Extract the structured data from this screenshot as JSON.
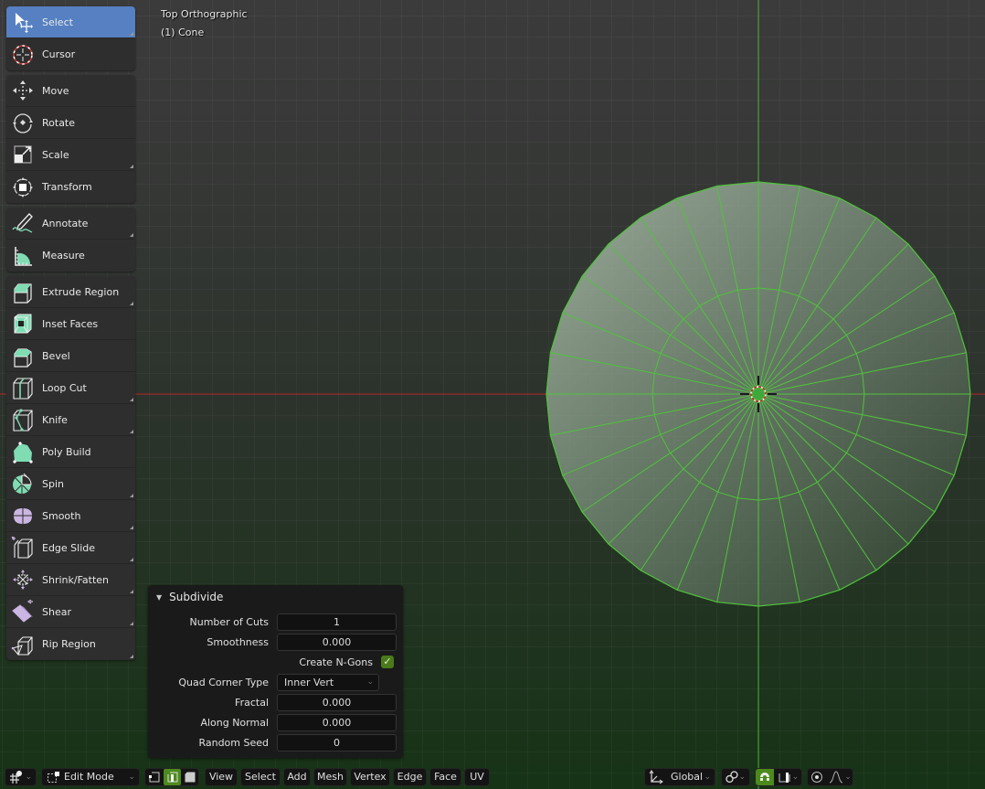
{
  "viewport": {
    "view_name": "Top Orthographic",
    "object_label": "(1) Cone",
    "mesh": {
      "segments": 32,
      "subdivision_rings": 2,
      "selected": true
    },
    "colors": {
      "x_axis": "#b22222",
      "y_axis": "#4caf39",
      "mesh_edge": "#4ec43a",
      "mesh_face": "#a3b8a3"
    }
  },
  "toolbar": {
    "groups": [
      [
        {
          "name": "select",
          "label": "Select",
          "icon": "select-box-icon",
          "active": true,
          "has_submenu": true
        },
        {
          "name": "cursor",
          "label": "Cursor",
          "icon": "cursor-icon",
          "active": false,
          "has_submenu": false
        }
      ],
      [
        {
          "name": "move",
          "label": "Move",
          "icon": "move-icon",
          "has_submenu": false
        },
        {
          "name": "rotate",
          "label": "Rotate",
          "icon": "rotate-icon",
          "has_submenu": false
        },
        {
          "name": "scale",
          "label": "Scale",
          "icon": "scale-icon",
          "has_submenu": true
        },
        {
          "name": "transform",
          "label": "Transform",
          "icon": "transform-icon",
          "has_submenu": false
        }
      ],
      [
        {
          "name": "annotate",
          "label": "Annotate",
          "icon": "annotate-icon",
          "has_submenu": true
        },
        {
          "name": "measure",
          "label": "Measure",
          "icon": "measure-icon",
          "has_submenu": false
        }
      ],
      [
        {
          "name": "extrude-region",
          "label": "Extrude Region",
          "icon": "extrude-icon",
          "has_submenu": true
        },
        {
          "name": "inset-faces",
          "label": "Inset Faces",
          "icon": "inset-icon",
          "has_submenu": false
        },
        {
          "name": "bevel",
          "label": "Bevel",
          "icon": "bevel-icon",
          "has_submenu": false
        },
        {
          "name": "loop-cut",
          "label": "Loop Cut",
          "icon": "loop-cut-icon",
          "has_submenu": true
        },
        {
          "name": "knife",
          "label": "Knife",
          "icon": "knife-icon",
          "has_submenu": true
        },
        {
          "name": "poly-build",
          "label": "Poly Build",
          "icon": "poly-build-icon",
          "has_submenu": false
        },
        {
          "name": "spin",
          "label": "Spin",
          "icon": "spin-icon",
          "has_submenu": true
        },
        {
          "name": "smooth",
          "label": "Smooth",
          "icon": "smooth-icon",
          "has_submenu": true
        },
        {
          "name": "edge-slide",
          "label": "Edge Slide",
          "icon": "edge-slide-icon",
          "has_submenu": true
        },
        {
          "name": "shrink-fatten",
          "label": "Shrink/Fatten",
          "icon": "shrink-fatten-icon",
          "has_submenu": true
        },
        {
          "name": "shear",
          "label": "Shear",
          "icon": "shear-icon",
          "has_submenu": true
        },
        {
          "name": "rip-region",
          "label": "Rip Region",
          "icon": "rip-icon",
          "has_submenu": true
        }
      ]
    ]
  },
  "operator_panel": {
    "title": "Subdivide",
    "number_of_cuts": {
      "label": "Number of Cuts",
      "value": "1"
    },
    "smoothness": {
      "label": "Smoothness",
      "value": "0.000"
    },
    "create_ngons": {
      "label": "Create N-Gons",
      "checked": true,
      "check_glyph": "✓"
    },
    "quad_corner_type": {
      "label": "Quad Corner Type",
      "value": "Inner Vert"
    },
    "fractal": {
      "label": "Fractal",
      "value": "0.000"
    },
    "along_normal": {
      "label": "Along Normal",
      "value": "0.000"
    },
    "random_seed": {
      "label": "Random Seed",
      "value": "0"
    }
  },
  "header": {
    "editor_type_icon": "3d-viewport-icon",
    "mode": "Edit Mode",
    "select_modes": [
      {
        "name": "vertex",
        "active": false
      },
      {
        "name": "edge",
        "active": true
      },
      {
        "name": "face",
        "active": false
      }
    ],
    "menus": [
      "View",
      "Select",
      "Add",
      "Mesh",
      "Vertex",
      "Edge",
      "Face",
      "UV"
    ],
    "orientation": "Global",
    "snap_active": true,
    "proportional": false
  }
}
